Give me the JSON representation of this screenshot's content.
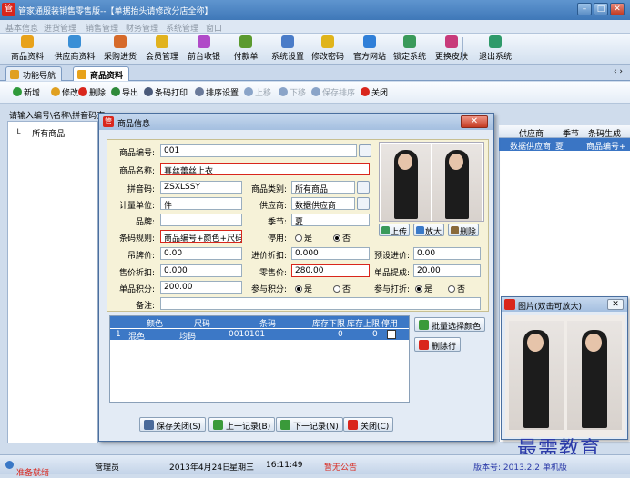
{
  "window": {
    "title": "管家通服装销售零售版--【单据抬头请修改分店全称】"
  },
  "menu": [
    "基本信息",
    "进货管理",
    "销售管理",
    "财务管理",
    "系统管理",
    "窗口"
  ],
  "toolbar": [
    {
      "label": "商品资料",
      "icon": "goods-icon",
      "color": "#e8a21a"
    },
    {
      "label": "供应商资料",
      "icon": "supplier-icon",
      "color": "#3a8fd6"
    },
    {
      "label": "采购进货",
      "icon": "purchase-icon",
      "color": "#d66a2a"
    },
    {
      "label": "会员管理",
      "icon": "member-icon",
      "color": "#e1b21e"
    },
    {
      "label": "前台收银",
      "icon": "cashier-icon",
      "color": "#b04ac8"
    },
    {
      "label": "付款单",
      "icon": "payment-icon",
      "color": "#5b9a2f"
    },
    {
      "label": "系统设置",
      "icon": "settings-icon",
      "color": "#4a7cc8"
    },
    {
      "label": "修改密码",
      "icon": "key-icon",
      "color": "#e0b41a"
    },
    {
      "label": "官方网站",
      "icon": "ie-icon",
      "color": "#2f7fd8"
    },
    {
      "label": "锁定系统",
      "icon": "lock-icon",
      "color": "#3a9a5a"
    },
    {
      "label": "更换皮肤",
      "icon": "skin-icon",
      "color": "#c83a7a"
    },
    {
      "label": "退出系统",
      "icon": "exit-icon",
      "color": "#2f9a6a"
    }
  ],
  "tabs": [
    {
      "label": "功能导航",
      "active": false
    },
    {
      "label": "商品资料",
      "active": true
    }
  ],
  "subtoolbar": [
    {
      "label": "新增",
      "color": "#2f9a3a",
      "disabled": false
    },
    {
      "label": "修改",
      "color": "#e0a020",
      "disabled": false
    },
    {
      "label": "删除",
      "color": "#d9261c",
      "disabled": false
    },
    {
      "label": "导出",
      "color": "#2f8a3a",
      "disabled": false
    },
    {
      "label": "条码打印",
      "color": "#4a5a7a",
      "disabled": false
    },
    {
      "label": "排序设置",
      "color": "#6a7a9a",
      "disabled": false
    },
    {
      "label": "上移",
      "color": "#8aa4c8",
      "disabled": true
    },
    {
      "label": "下移",
      "color": "#8aa4c8",
      "disabled": true
    },
    {
      "label": "保存排序",
      "color": "#8aa4c8",
      "disabled": true
    },
    {
      "label": "关闭",
      "color": "#d9261c",
      "disabled": false
    }
  ],
  "search_hint": "请输入编号\\名称\\拼音码查",
  "tree": {
    "root": "所有商品"
  },
  "grid": {
    "headers": [
      "供应商",
      "季节",
      "条码生成"
    ],
    "row": [
      "数据供应商",
      "夏",
      "商品编号+"
    ]
  },
  "dialog": {
    "title": "商品信息",
    "close": "✕",
    "fields": {
      "code": {
        "label": "商品编号:",
        "value": "001"
      },
      "name": {
        "label": "商品名称:",
        "value": "真丝蕾丝上衣"
      },
      "pinyin": {
        "label": "拼音码:",
        "value": "ZSXLSSY"
      },
      "category": {
        "label": "商品类别:",
        "value": "所有商品"
      },
      "unit": {
        "label": "计量单位:",
        "value": "件"
      },
      "supplier": {
        "label": "供应商:",
        "value": "数据供应商"
      },
      "brand": {
        "label": "品牌:",
        "value": ""
      },
      "season": {
        "label": "季节:",
        "value": "夏"
      },
      "barcode_rule": {
        "label": "条码规则:",
        "value": "商品编号+颜色+尺码"
      },
      "disabled": {
        "label": "停用:",
        "yes": "是",
        "no": "否",
        "selected": "no"
      },
      "tag_price": {
        "label": "吊牌价:",
        "value": "0.00"
      },
      "purchase_discount": {
        "label": "进价折扣:",
        "value": "0.000"
      },
      "preset_cost": {
        "label": "预设进价:",
        "value": "0.00"
      },
      "sale_discount": {
        "label": "售价折扣:",
        "value": "0.000"
      },
      "retail_price": {
        "label": "零售价:",
        "value": "280.00"
      },
      "commission": {
        "label": "单品提成:",
        "value": "20.00"
      },
      "points": {
        "label": "单品积分:",
        "value": "200.00"
      },
      "join_points": {
        "label": "参与积分:",
        "yes": "是",
        "no": "否",
        "selected": "yes"
      },
      "join_discount": {
        "label": "参与打折:",
        "yes": "是",
        "no": "否",
        "selected": "yes"
      },
      "remark": {
        "label": "备注:",
        "value": ""
      }
    },
    "photo_buttons": [
      "上传",
      "放大",
      "删除"
    ],
    "sku": {
      "headers": [
        "颜色",
        "尺码",
        "条码",
        "库存下限",
        "库存上限",
        "停用"
      ],
      "rows": [
        {
          "index": "1",
          "color": "混色",
          "size": "均码",
          "barcode": "0010101",
          "min": "0",
          "max": "0"
        }
      ]
    },
    "side_buttons": [
      "批量选择颜色",
      "删除行"
    ],
    "bottom_buttons": [
      "保存关闭(S)",
      "上一记录(B)",
      "下一记录(N)",
      "关闭(C)"
    ]
  },
  "image_window": {
    "title": "图片(双击可放大)",
    "close": "✕"
  },
  "status": {
    "ready": "准备就绪",
    "user": "管理员",
    "date": "2013年4月24日",
    "weekday": "星期三",
    "time": "16:11:49",
    "notice": "暂无公告",
    "version": "版本号: 2013.2.2 单机版"
  },
  "watermark": "最需教育"
}
